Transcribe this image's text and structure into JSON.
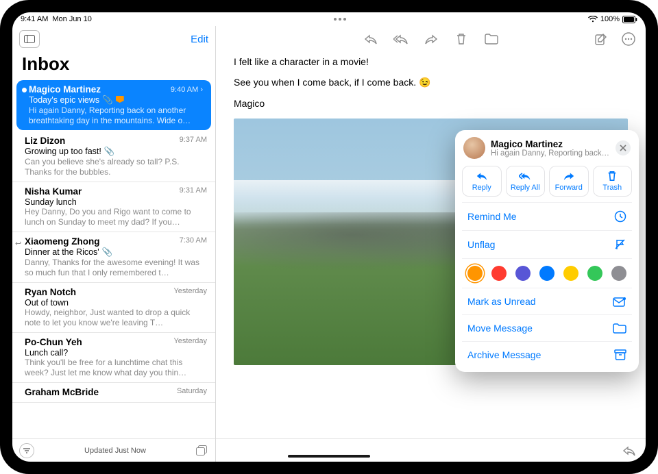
{
  "status": {
    "time": "9:41 AM",
    "date": "Mon Jun 10",
    "battery": "100%",
    "wifi_icon": "wifi",
    "battery_icon": "battery-full"
  },
  "sidebar": {
    "edit_label": "Edit",
    "title": "Inbox",
    "footer_status": "Updated Just Now"
  },
  "messages": [
    {
      "sender": "Magico Martinez",
      "time": "9:40 AM",
      "subject": "Today's epic views",
      "preview": "Hi again Danny, Reporting back on another breathtaking day in the mountains. Wide o…",
      "selected": true,
      "unread": true,
      "attachment": true,
      "flagged": true
    },
    {
      "sender": "Liz Dizon",
      "time": "9:37 AM",
      "subject": "Growing up too fast!",
      "preview": "Can you believe she's already so tall? P.S. Thanks for the bubbles.",
      "attachment": true
    },
    {
      "sender": "Nisha Kumar",
      "time": "9:31 AM",
      "subject": "Sunday lunch",
      "preview": "Hey Danny, Do you and Rigo want to come to lunch on Sunday to meet my dad? If you…"
    },
    {
      "sender": "Xiaomeng Zhong",
      "time": "7:30 AM",
      "subject": "Dinner at the Ricos'",
      "preview": "Danny, Thanks for the awesome evening! It was so much fun that I only remembered t…",
      "replied": true,
      "attachment": true
    },
    {
      "sender": "Ryan Notch",
      "time": "Yesterday",
      "subject": "Out of town",
      "preview": "Howdy, neighbor, Just wanted to drop a quick note to let you know we're leaving T…"
    },
    {
      "sender": "Po-Chun Yeh",
      "time": "Yesterday",
      "subject": "Lunch call?",
      "preview": "Think you'll be free for a lunchtime chat this week? Just let me know what day you thin…"
    },
    {
      "sender": "Graham McBride",
      "time": "Saturday",
      "subject": "",
      "preview": ""
    }
  ],
  "reader": {
    "line1": "I felt like a character in a movie!",
    "line2": "See you when I come back, if I come back. 😉",
    "signature": "Magico"
  },
  "popover": {
    "name": "Magico Martinez",
    "preview": "Hi again Danny, Reporting back o…",
    "actions": {
      "reply": "Reply",
      "reply_all": "Reply All",
      "forward": "Forward",
      "trash": "Trash"
    },
    "rows": {
      "remind": "Remind Me",
      "unflag": "Unflag",
      "mark_unread": "Mark as Unread",
      "move": "Move Message",
      "archive": "Archive Message"
    },
    "flag_colors": [
      "#ff9500",
      "#ff3b30",
      "#5856d6",
      "#007aff",
      "#ffcc00",
      "#34c759",
      "#8e8e93"
    ],
    "flag_selected_index": 0
  }
}
